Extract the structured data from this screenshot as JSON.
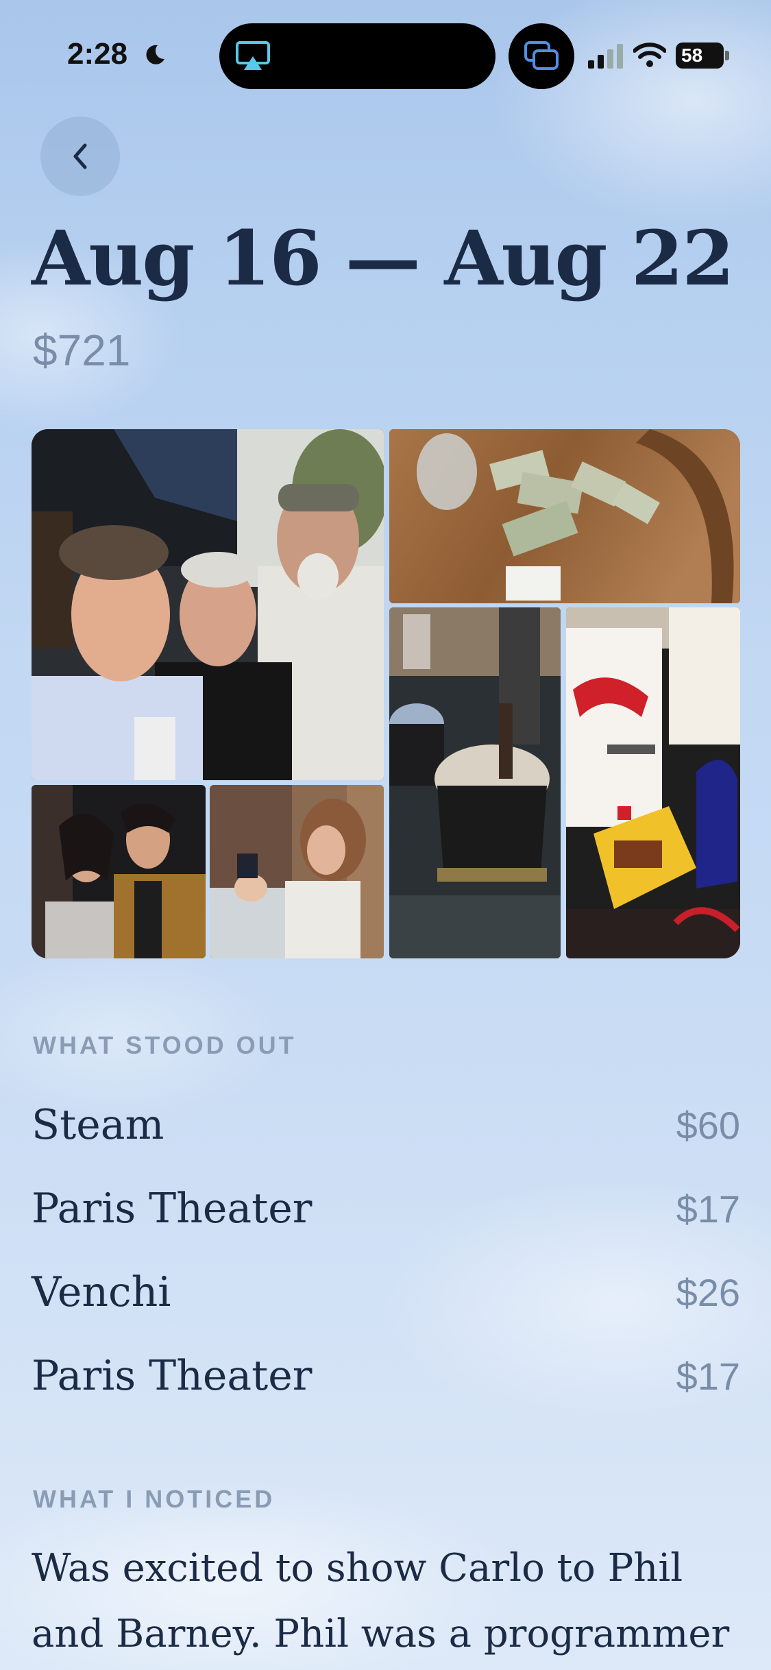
{
  "status_bar": {
    "time": "2:28",
    "battery": "58"
  },
  "header": {
    "title": "Aug 16 — Aug 22",
    "total": "$721"
  },
  "photos": [
    {
      "name": "selfie-three-men"
    },
    {
      "name": "cash-on-table"
    },
    {
      "name": "venchi-gelato"
    },
    {
      "name": "rays-candy-bag"
    },
    {
      "name": "west-side-story-still"
    },
    {
      "name": "woman-eating-gelato"
    }
  ],
  "what_stood_out": {
    "label": "WHAT STOOD OUT",
    "items": [
      {
        "name": "Steam",
        "amount": "$60"
      },
      {
        "name": "Paris Theater",
        "amount": "$17"
      },
      {
        "name": "Venchi",
        "amount": "$26"
      },
      {
        "name": "Paris Theater",
        "amount": "$17"
      }
    ]
  },
  "what_i_noticed": {
    "label": "WHAT I NOTICED",
    "text": "Was excited to show Carlo to Phil and Barney. Phil was a programmer"
  },
  "colors": {
    "title": "#1c2b45",
    "muted": "#7a8da8",
    "label": "#8a9cb4"
  }
}
